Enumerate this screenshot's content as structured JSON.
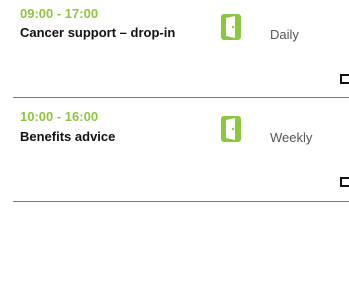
{
  "colors": {
    "accent": "#8dc63f",
    "text": "#111111",
    "muted": "#555555",
    "divider": "#777777"
  },
  "sessions": [
    {
      "time": "09:00 - 17:00",
      "title": "Cancer support – drop-in",
      "icon": "open-door-icon",
      "frequency": "Daily"
    },
    {
      "time": "10:00 - 16:00",
      "title": "Benefits advice",
      "icon": "open-door-icon",
      "frequency": "Weekly"
    }
  ]
}
